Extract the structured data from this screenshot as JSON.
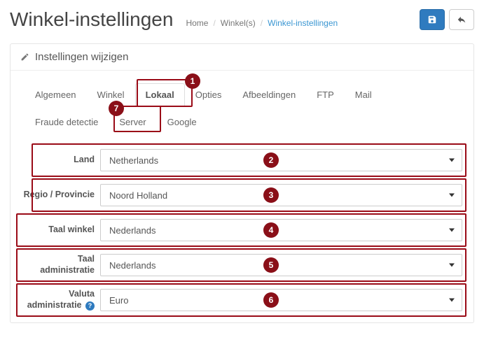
{
  "header": {
    "title": "Winkel-instellingen",
    "breadcrumb": {
      "home": "Home",
      "stores": "Winkel(s)",
      "current": "Winkel-instellingen"
    }
  },
  "panel": {
    "title": "Instellingen wijzigen"
  },
  "tabs": {
    "algemeen": "Algemeen",
    "winkel": "Winkel",
    "lokaal": "Lokaal",
    "opties": "Opties",
    "afbeeldingen": "Afbeeldingen",
    "ftp": "FTP",
    "mail": "Mail",
    "fraude": "Fraude detectie",
    "server": "Server",
    "google": "Google"
  },
  "annotations": {
    "lokaal": "1",
    "server": "7"
  },
  "form": {
    "land": {
      "label": "Land",
      "value": "Netherlands",
      "badge": "2"
    },
    "regio": {
      "label": "Regio / Provincie",
      "value": "Noord Holland",
      "badge": "3"
    },
    "taalw": {
      "label": "Taal winkel",
      "value": "Nederlands",
      "badge": "4"
    },
    "taala": {
      "label": "Taal administratie",
      "value": "Nederlands",
      "badge": "5"
    },
    "valuta": {
      "label": "Valuta administratie",
      "value": "Euro",
      "badge": "6"
    }
  }
}
